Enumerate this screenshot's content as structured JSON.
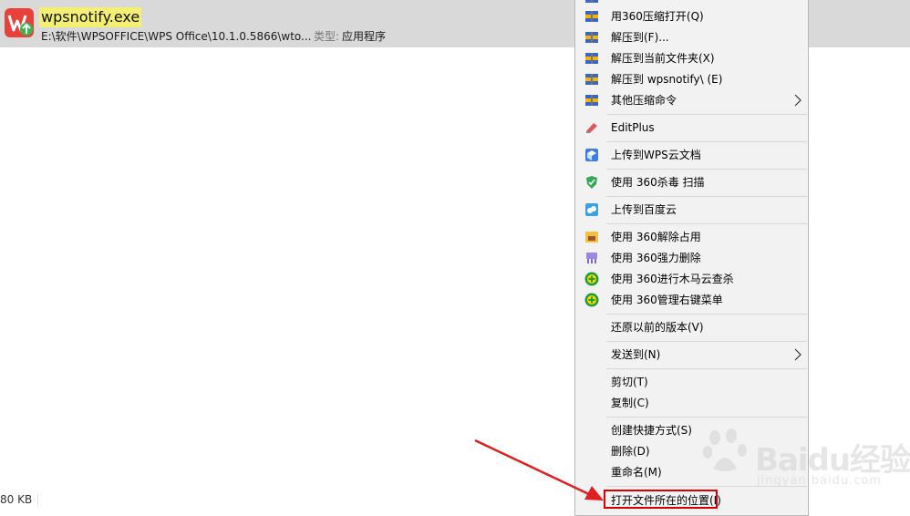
{
  "result": {
    "name": "wpsnotify.exe",
    "path": "E:\\软件\\WPSOFFICE\\WPS Office\\10.1.0.5866\\wto...",
    "type_label": "类型:",
    "type_value": "应用程序"
  },
  "footer": {
    "size": "80 KB"
  },
  "menu": {
    "items": {
      "open360": "用360压缩打开(Q)",
      "extract_to": "解压到(F)...",
      "extract_here": "解压到当前文件夹(X)",
      "extract_folder": "解压到 wpsnotify\\ (E)",
      "other_compress": "其他压缩命令",
      "editplus": "EditPlus",
      "upload_wps": "上传到WPS云文档",
      "scan360": "使用 360杀毒 扫描",
      "upload_baidu": "上传到百度云",
      "unlock360": "使用 360解除占用",
      "force_delete": "使用 360强力删除",
      "trojan_scan": "使用 360进行木马云查杀",
      "manage_menu": "使用 360管理右键菜单",
      "restore": "还原以前的版本(V)",
      "send_to": "发送到(N)",
      "cut": "剪切(T)",
      "copy": "复制(C)",
      "shortcut": "创建快捷方式(S)",
      "delete": "删除(D)",
      "rename": "重命名(M)",
      "open_location": "打开文件所在的位置(I)"
    }
  },
  "watermark": {
    "text": "Baidu经验",
    "url": "jingyan.baidu.com"
  },
  "colors": {
    "highlight": "#d80000",
    "name_highlight": "#f3ef74",
    "row_bg": "#d9d9d9"
  }
}
